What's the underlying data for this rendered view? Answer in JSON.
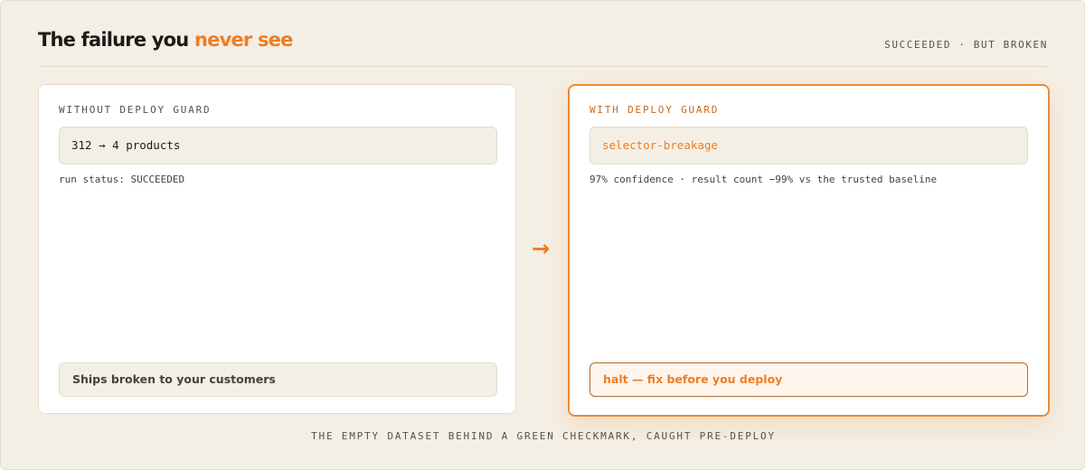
{
  "header": {
    "title_prefix": "The failure you",
    "title_accent": "never see",
    "tag": "SUCCEEDED · BUT BROKEN"
  },
  "without": {
    "label": "WITHOUT DEPLOY GUARD",
    "value": "312 → 4 products",
    "meta": "run status: SUCCEEDED",
    "footer": "Ships broken to your customers"
  },
  "with": {
    "label": "WITH DEPLOY GUARD",
    "value": "selector-breakage",
    "meta": "97% confidence · result count −99% vs the trusted baseline",
    "footer": "halt — fix before you deploy"
  },
  "arrow": "→",
  "caption": "THE EMPTY DATASET BEHIND A GREEN CHECKMARK, CAUGHT PRE-DEPLOY",
  "colors": {
    "accent": "#f07d22",
    "background": "#f4efe5"
  }
}
